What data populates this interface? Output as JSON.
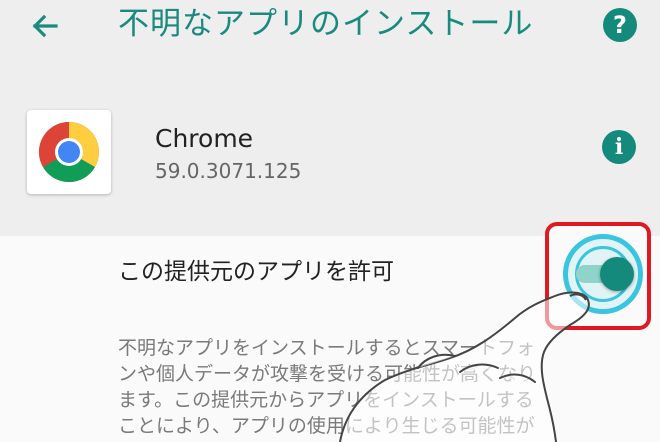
{
  "header": {
    "title": "不明なアプリのインストール",
    "back_icon": "arrow-back-icon",
    "help_icon": "help-icon",
    "help_glyph": "?"
  },
  "app": {
    "name": "Chrome",
    "version": "59.0.3071.125",
    "icon": "chrome-logo-icon",
    "info_icon": "info-icon",
    "info_glyph": "i"
  },
  "allow": {
    "label": "この提供元のアプリを許可",
    "toggle_on": true,
    "description": "不明なアプリをインストールするとスマートフォ\nンや個人データが攻撃を受ける可能性が高くなり\nます。この提供元からアプリをインストールする\nことにより、アプリの使用により生じる可能性が"
  },
  "colors": {
    "accent": "#148a7c",
    "title_text": "#1a8a7e",
    "highlight_box": "#e01822",
    "ripple": "#39c4e0"
  }
}
